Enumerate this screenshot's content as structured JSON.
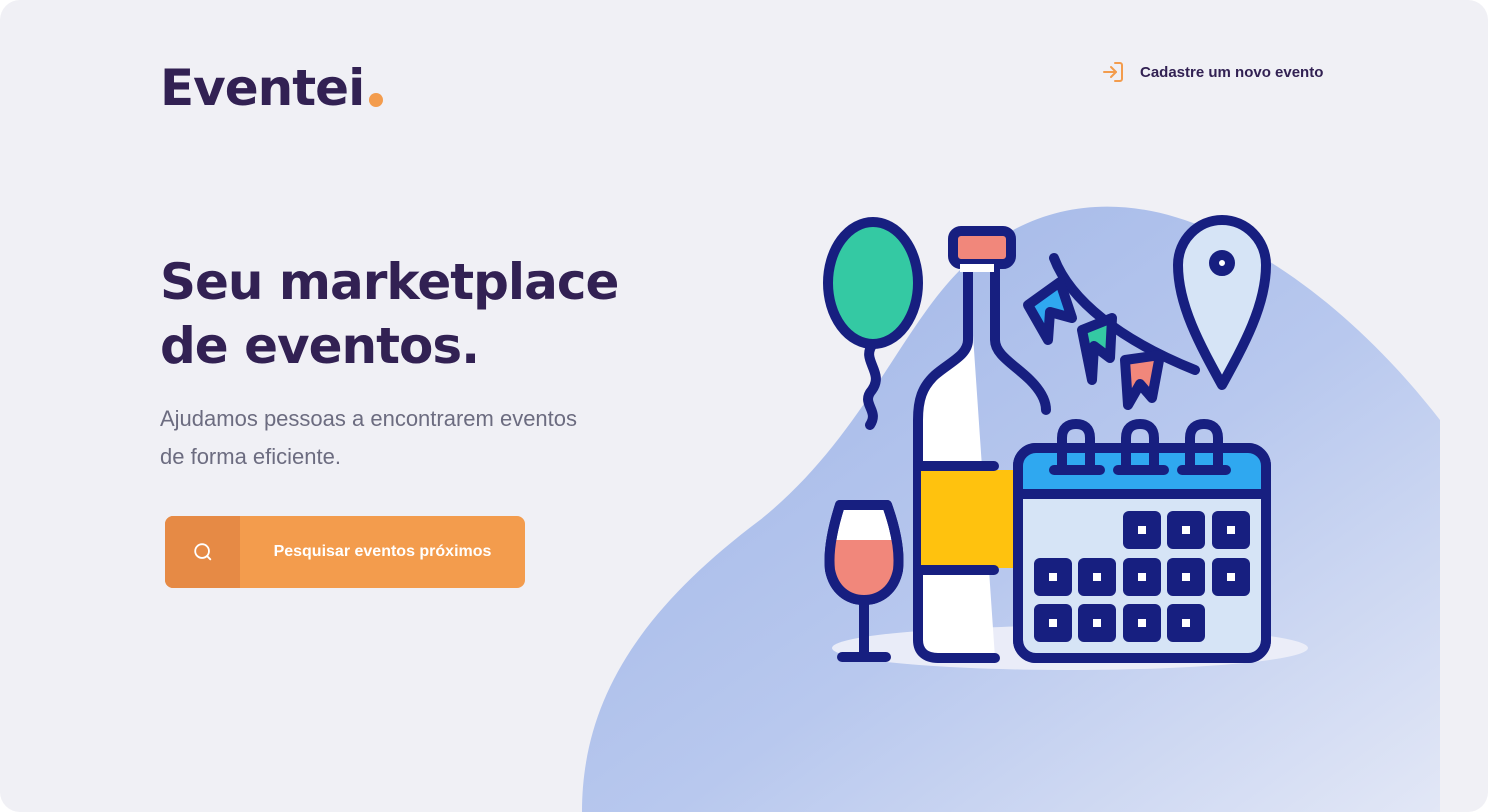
{
  "brand": {
    "name": "Eventei",
    "accent_color": "#f39c4d",
    "text_color": "#322153"
  },
  "header": {
    "register_link_label": "Cadastre um novo evento",
    "register_link_icon": "log-in-icon"
  },
  "hero": {
    "title": "Seu marketplace de eventos.",
    "subtitle": "Ajudamos pessoas a encontrarem eventos de forma eficiente."
  },
  "cta": {
    "label": "Pesquisar eventos próximos",
    "icon": "search-icon",
    "color": "#f39c4d",
    "icon_bg_color": "#e68a45"
  },
  "illustration": {
    "elements": [
      "balloon-icon",
      "wine-bottle-icon",
      "wine-glass-icon",
      "bunting-flags-icon",
      "location-pin-icon",
      "calendar-icon"
    ]
  }
}
